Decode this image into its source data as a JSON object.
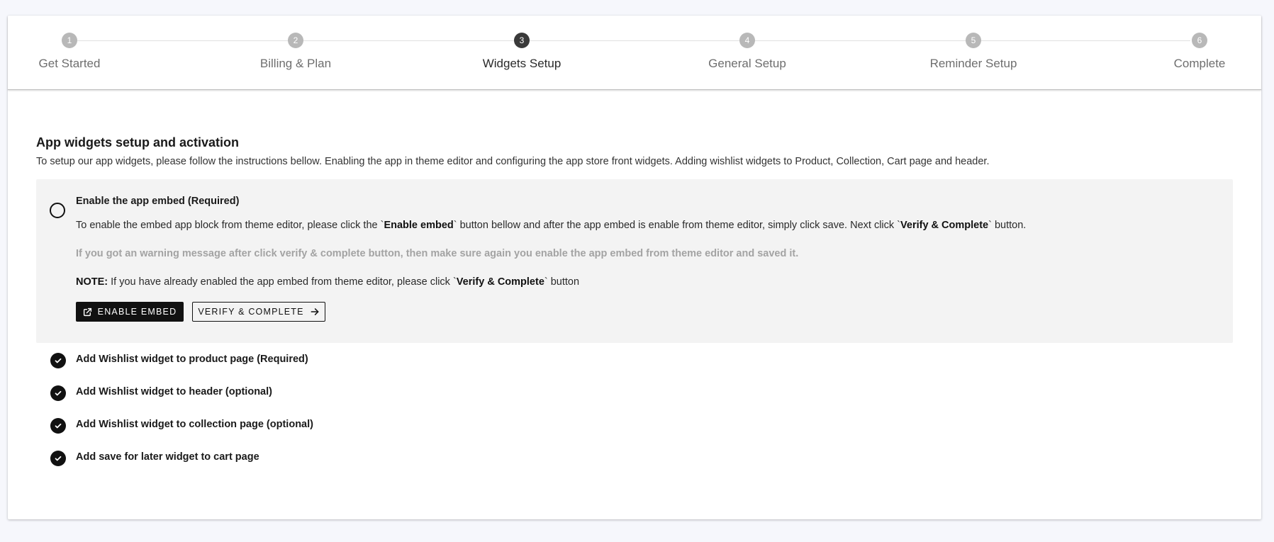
{
  "stepper": {
    "steps": [
      {
        "number": "1",
        "label": "Get Started"
      },
      {
        "number": "2",
        "label": "Billing & Plan"
      },
      {
        "number": "3",
        "label": "Widgets Setup"
      },
      {
        "number": "4",
        "label": "General Setup"
      },
      {
        "number": "5",
        "label": "Reminder Setup"
      },
      {
        "number": "6",
        "label": "Complete"
      }
    ],
    "active_step": 3
  },
  "section": {
    "title": "App widgets setup and activation",
    "description": "To setup our app widgets, please follow the instructions bellow. Enabling the app in theme editor and configuring the app store front widgets. Adding wishlist widgets to Product, Collection, Cart page and header."
  },
  "embed_task": {
    "title": "Enable the app embed (Required)",
    "instruction_part1": "To enable the embed app block from theme editor, please click the `",
    "instruction_bold1": "Enable embed",
    "instruction_part2": "` button bellow and after the app embed is enable from theme editor, simply click save. Next click `",
    "instruction_bold2": "Verify & Complete",
    "instruction_part3": "` button.",
    "warning": "If you got an warning message after click verify & complete button, then make sure again you enable the app embed from theme editor and saved it.",
    "note_label": "NOTE:",
    "note_part1": " If you have already enabled the app embed from theme editor, please click `",
    "note_bold": "Verify & Complete",
    "note_part2": "` button",
    "enable_button": "ENABLE EMBED",
    "verify_button": "VERIFY & COMPLETE"
  },
  "completed_tasks": [
    "Add Wishlist widget to product page (Required)",
    "Add Wishlist widget to header (optional)",
    "Add Wishlist widget to collection page (optional)",
    "Add save for later widget to cart page"
  ],
  "colors": {
    "background": "#f6f7fc",
    "step_inactive": "#b8b8b8",
    "step_active": "#3a3a3a",
    "panel": "#f3f3f3",
    "button_dark": "#111111"
  },
  "icons": {
    "enable_button_icon": "external-link-icon",
    "verify_button_icon": "arrow-right-icon",
    "pending_task_icon": "radio-unchecked-icon",
    "completed_task_icon": "check-circle-icon"
  }
}
